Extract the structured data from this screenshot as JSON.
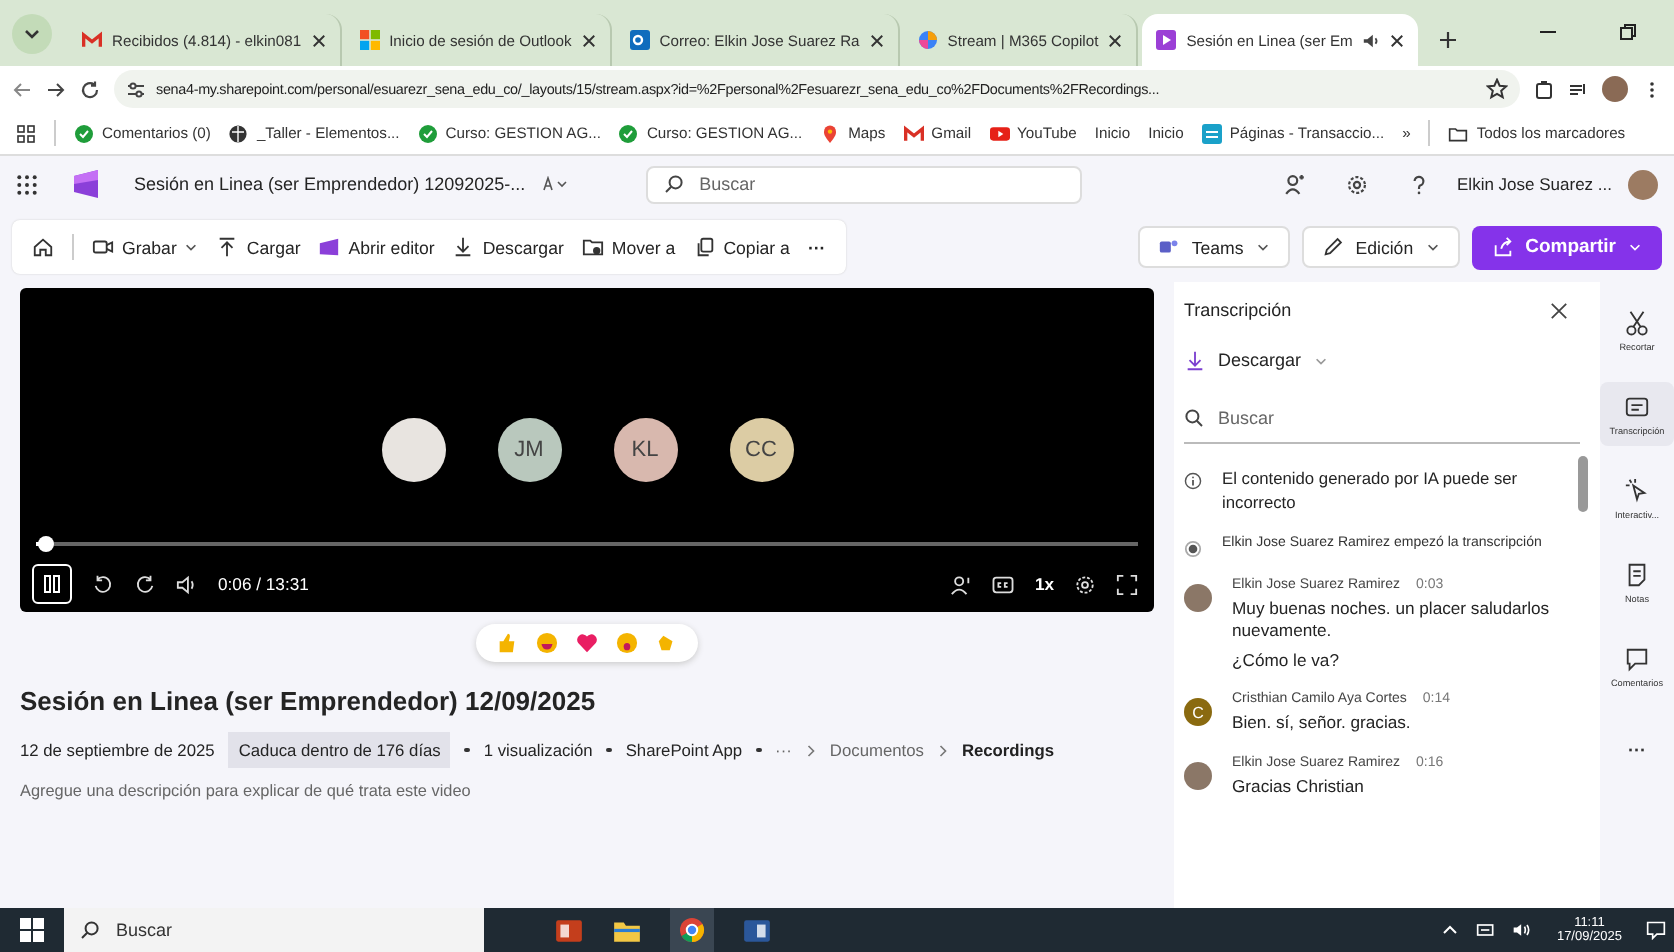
{
  "browser_tabs": [
    {
      "kind": "gmail",
      "label": "Recibidos (4.814) - elkin081",
      "selected": false
    },
    {
      "kind": "windows",
      "label": "Inicio de sesión de Outlook",
      "selected": false
    },
    {
      "kind": "outlook",
      "label": "Correo: Elkin Jose Suarez Ra",
      "selected": false
    },
    {
      "kind": "copilot",
      "label": "Stream | M365 Copilot",
      "selected": false
    },
    {
      "kind": "stream",
      "label": "Sesión en Linea (ser Em",
      "selected": true
    }
  ],
  "address_bar": {
    "url": "sena4-my.sharepoint.com/personal/esuarezr_sena_edu_co/_layouts/15/stream.aspx?id=%2Fpersonal%2Fesuarezr_sena_edu_co%2FDocuments%2FRecordings..."
  },
  "bookmarks": [
    {
      "kind": "green",
      "label": "Comentarios (0)"
    },
    {
      "kind": "globe",
      "label": "_Taller - Elementos..."
    },
    {
      "kind": "green",
      "label": "Curso: GESTION AG..."
    },
    {
      "kind": "green",
      "label": "Curso: GESTION AG..."
    },
    {
      "kind": "maps",
      "label": "Maps"
    },
    {
      "kind": "gmail",
      "label": "Gmail"
    },
    {
      "kind": "youtube",
      "label": "YouTube"
    },
    {
      "kind": "blank",
      "label": "Inicio"
    },
    {
      "kind": "blank",
      "label": "Inicio"
    },
    {
      "kind": "pages",
      "label": "Páginas - Transaccio..."
    },
    {
      "kind": "more",
      "label": "»"
    },
    {
      "kind": "folder",
      "label": "Todos los marcadores"
    }
  ],
  "app_header": {
    "title": "Sesión en Linea (ser Emprendedor) 12092025-...",
    "search_placeholder": "Buscar",
    "user": "Elkin Jose Suarez ..."
  },
  "toolbar": {
    "items": [
      {
        "kind": "record",
        "label": "Grabar"
      },
      {
        "kind": "upload",
        "label": "Cargar"
      },
      {
        "kind": "editor",
        "label": "Abrir editor"
      },
      {
        "kind": "download",
        "label": "Descargar"
      },
      {
        "kind": "move",
        "label": "Mover a"
      },
      {
        "kind": "copy",
        "label": "Copiar a"
      },
      {
        "kind": "more",
        "label": "···"
      }
    ],
    "teams": "Teams",
    "edit": "Edición",
    "share": "Compartir"
  },
  "video": {
    "participants": [
      {
        "kind": "photo"
      },
      {
        "kind": "initials",
        "initials": "JM",
        "color": "#b9c8bd"
      },
      {
        "kind": "initials",
        "initials": "KL",
        "color": "#d8b8ae"
      },
      {
        "kind": "initials",
        "initials": "CC",
        "color": "#dccca4"
      }
    ],
    "progress": {
      "level": 0.008
    },
    "time": "0:06 / 13:31",
    "speed": "1x",
    "playing": true
  },
  "title": "Sesión en Linea (ser Emprendedor) 12/09/2025",
  "meta": {
    "date": "12 de septiembre de 2025",
    "expiry": "Caduca dentro de 176 días",
    "views": "1 visualización",
    "app": "SharePoint App",
    "breadcrumb": [
      "···",
      "Documentos",
      "Recordings"
    ]
  },
  "description_placeholder": "Agregue una descripción para explicar de qué trata este video",
  "transcript": {
    "title": "Transcripción",
    "download": "Descargar",
    "search_placeholder": "Buscar",
    "entries": [
      {
        "kind": "notice",
        "text": "El contenido generado por IA puede ser incorrecto"
      },
      {
        "kind": "event",
        "text": "Elkin Jose Suarez Ramirez empezó la transcripción"
      },
      {
        "kind": "speech",
        "speaker": "Elkin Jose Suarez Ramirez",
        "time": "0:03",
        "lines": [
          "Muy buenas noches. un placer saludarlos nuevamente.",
          "¿Cómo le va?"
        ]
      },
      {
        "kind": "speech",
        "initial": "C",
        "color": "#8a6a10",
        "speaker": "Cristhian Camilo Aya Cortes",
        "time": "0:14",
        "lines": [
          "Bien. sí, señor. gracias."
        ]
      },
      {
        "kind": "speech",
        "speaker": "Elkin Jose Suarez Ramirez",
        "time": "0:16",
        "lines": [
          "Gracias Christian"
        ]
      }
    ]
  },
  "side_rail": [
    {
      "kind": "trim",
      "label": "Recortar",
      "selected": false
    },
    {
      "kind": "transcript",
      "label": "Transcripción",
      "selected": true
    },
    {
      "kind": "interactive",
      "label": "Interactiv...",
      "selected": false
    },
    {
      "kind": "notes",
      "label": "Notas",
      "selected": false
    },
    {
      "kind": "comments",
      "label": "Comentarios",
      "selected": false
    },
    {
      "kind": "more",
      "label": "···",
      "selected": false
    }
  ],
  "taskbar": {
    "search_placeholder": "Buscar",
    "time": "11:11",
    "date": "17/09/2025"
  }
}
